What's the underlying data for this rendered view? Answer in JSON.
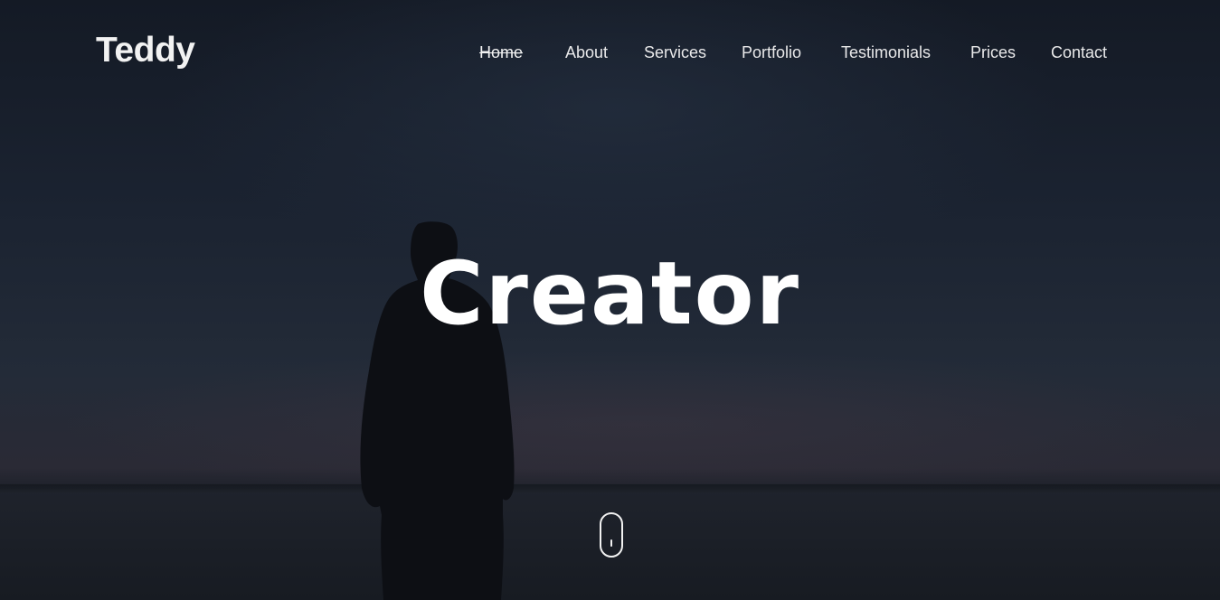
{
  "brand": {
    "name": "Teddy"
  },
  "nav": {
    "items": [
      {
        "label": "Home",
        "active": true
      },
      {
        "label": "About",
        "active": false
      },
      {
        "label": "Services",
        "active": false
      },
      {
        "label": "Portfolio",
        "active": false
      },
      {
        "label": "Testimonials",
        "active": false
      },
      {
        "label": "Prices",
        "active": false
      },
      {
        "label": "Contact",
        "active": false
      }
    ]
  },
  "hero": {
    "title": "Creator",
    "background_icon": "person-silhouette-at-dusk",
    "scroll_icon": "mouse-scroll-icon"
  },
  "colors": {
    "text": "#ffffff",
    "nav_text": "#e9e9ea",
    "sky_top": "#141a25",
    "sky_mid": "#232b38"
  }
}
